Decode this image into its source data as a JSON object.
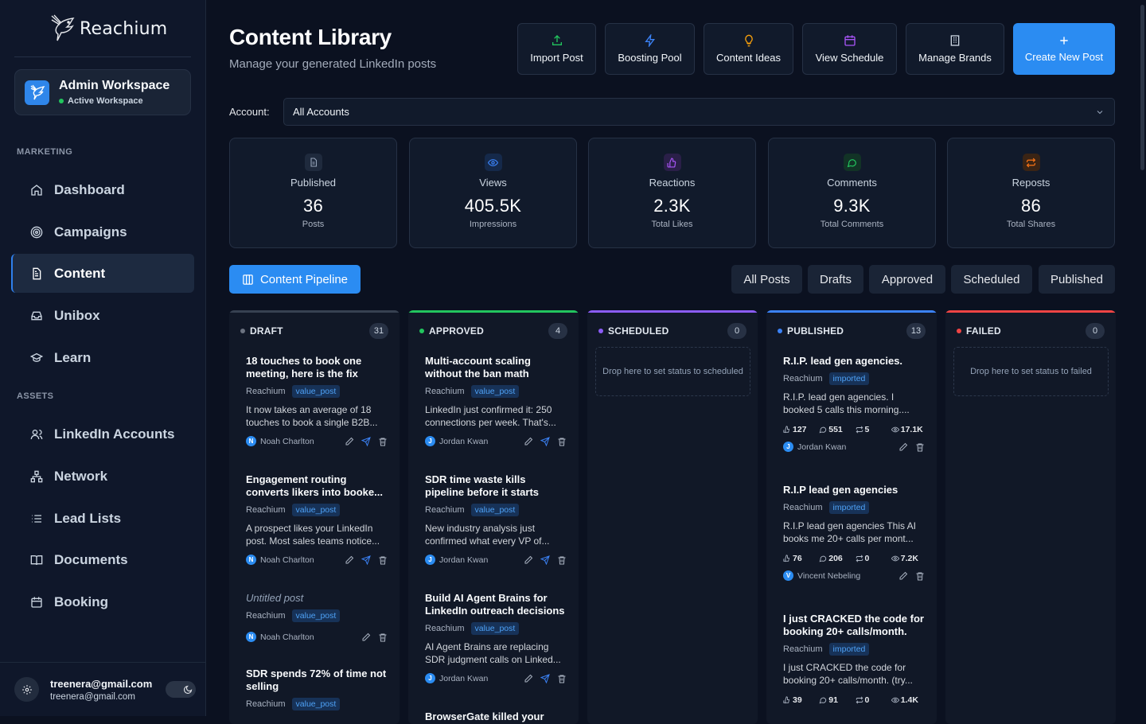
{
  "brand": {
    "name": "Reachium"
  },
  "workspace": {
    "name": "Admin Workspace",
    "status": "Active Workspace"
  },
  "sidebar": {
    "sections": [
      {
        "label": "MARKETING"
      },
      {
        "label": "ASSETS"
      }
    ],
    "items": [
      {
        "label": "Dashboard",
        "icon": "home-icon"
      },
      {
        "label": "Campaigns",
        "icon": "target-icon"
      },
      {
        "label": "Content",
        "icon": "document-icon",
        "active": true
      },
      {
        "label": "Unibox",
        "icon": "inbox-icon"
      },
      {
        "label": "Learn",
        "icon": "graduation-cap-icon"
      },
      {
        "label": "LinkedIn Accounts",
        "icon": "users-icon"
      },
      {
        "label": "Network",
        "icon": "network-icon"
      },
      {
        "label": "Lead Lists",
        "icon": "list-icon"
      },
      {
        "label": "Documents",
        "icon": "book-icon"
      },
      {
        "label": "Booking",
        "icon": "calendar-icon"
      }
    ]
  },
  "user": {
    "name": "treenera@gmail.com",
    "email": "treenera@gmail.com"
  },
  "header": {
    "title": "Content Library",
    "subtitle": "Manage your generated LinkedIn posts"
  },
  "toolbar": {
    "import": "Import Post",
    "boosting": "Boosting Pool",
    "ideas": "Content Ideas",
    "schedule": "View Schedule",
    "brands": "Manage Brands",
    "create": "Create New Post"
  },
  "account": {
    "label": "Account:",
    "value": "All Accounts"
  },
  "stats": [
    {
      "label": "Published",
      "value": "36",
      "sub": "Posts",
      "color": "#94a3b8"
    },
    {
      "label": "Views",
      "value": "405.5K",
      "sub": "Impressions",
      "color": "#3b82f6"
    },
    {
      "label": "Reactions",
      "value": "2.3K",
      "sub": "Total Likes",
      "color": "#a855f7"
    },
    {
      "label": "Comments",
      "value": "9.3K",
      "sub": "Total Comments",
      "color": "#22c55e"
    },
    {
      "label": "Reposts",
      "value": "86",
      "sub": "Total Shares",
      "color": "#f97316"
    }
  ],
  "pipeline": {
    "label": "Content Pipeline"
  },
  "filters": [
    "All Posts",
    "Drafts",
    "Approved",
    "Scheduled",
    "Published"
  ],
  "columns": [
    {
      "name": "DRAFT",
      "count": "31",
      "color": "#6b7280"
    },
    {
      "name": "APPROVED",
      "count": "4",
      "color": "#22c55e"
    },
    {
      "name": "SCHEDULED",
      "count": "0",
      "color": "#8b5cf6",
      "drop": "Drop here to set status to scheduled"
    },
    {
      "name": "PUBLISHED",
      "count": "13",
      "color": "#3b82f6"
    },
    {
      "name": "FAILED",
      "count": "0",
      "color": "#ef4444",
      "drop": "Drop here to set status to failed"
    }
  ],
  "draft_cards": [
    {
      "title": "18 touches to book one meeting, here is the fix",
      "brand": "Reachium",
      "tag": "value_post",
      "body": "It now takes an average of 18 touches to book a single B2B...",
      "author": "Noah Charlton",
      "initial": "N"
    },
    {
      "title": "Engagement routing converts likers into booke...",
      "brand": "Reachium",
      "tag": "value_post",
      "body": "A prospect likes your LinkedIn post. Most sales teams notice...",
      "author": "Noah Charlton",
      "initial": "N"
    },
    {
      "title": "Untitled post",
      "brand": "Reachium",
      "tag": "value_post",
      "author": "Noah Charlton",
      "initial": "N"
    },
    {
      "title": "SDR spends 72% of time not selling",
      "brand": "Reachium",
      "tag": "value_post"
    }
  ],
  "approved_cards": [
    {
      "title": "Multi-account scaling without the ban math",
      "brand": "Reachium",
      "tag": "value_post",
      "body": "LinkedIn just confirmed it: 250 connections per week. That's...",
      "author": "Jordan Kwan",
      "initial": "J"
    },
    {
      "title": "SDR time waste kills pipeline before it starts",
      "brand": "Reachium",
      "tag": "value_post",
      "body": "New industry analysis just confirmed what every VP of...",
      "author": "Jordan Kwan",
      "initial": "J"
    },
    {
      "title": "Build AI Agent Brains for LinkedIn outreach decisions",
      "brand": "Reachium",
      "tag": "value_post",
      "body": "AI Agent Brains are replacing SDR judgment calls on Linked...",
      "author": "Jordan Kwan",
      "initial": "J"
    },
    {
      "title": "BrowserGate killed your"
    }
  ],
  "published_cards": [
    {
      "title": "R.I.P. lead gen agencies.",
      "brand": "Reachium",
      "tag": "imported",
      "body": "R.I.P. lead gen agencies. I booked 5 calls this morning....",
      "likes": "127",
      "comments": "551",
      "reposts": "5",
      "views": "17.1K",
      "author": "Jordan Kwan",
      "initial": "J"
    },
    {
      "title": "R.I.P lead gen agencies",
      "brand": "Reachium",
      "tag": "imported",
      "body": "R.I.P lead gen agencies This AI books me 20+ calls per mont...",
      "likes": "76",
      "comments": "206",
      "reposts": "0",
      "views": "7.2K",
      "author": "Vincent Nebeling",
      "initial": "V"
    },
    {
      "title": "I just CRACKED the code for booking 20+ calls/month.",
      "brand": "Reachium",
      "tag": "imported",
      "body": "I just CRACKED the code for booking 20+ calls/month. (try...",
      "likes": "39",
      "comments": "91",
      "reposts": "0",
      "views": "1.4K"
    }
  ]
}
